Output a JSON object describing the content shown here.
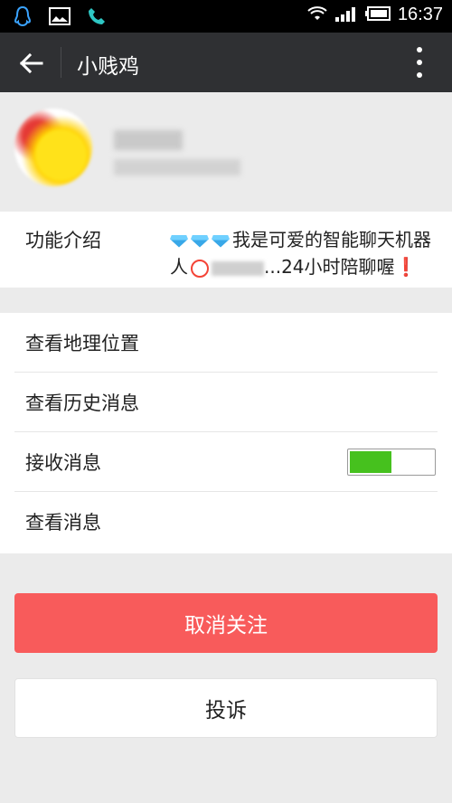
{
  "status_bar": {
    "time": "16:37",
    "left_icons": [
      "qq-icon",
      "image-icon",
      "phone-icon"
    ],
    "right_icons": [
      "wifi-icon",
      "signal-icon",
      "battery-icon"
    ]
  },
  "header": {
    "title": "小贱鸡"
  },
  "intro": {
    "label": "功能介绍",
    "text_part1": "我是可爱的智能聊天机器人",
    "text_part2": "...24小时陪聊喔",
    "exclaim": "❗"
  },
  "options": [
    {
      "label": "查看地理位置"
    },
    {
      "label": "查看历史消息"
    },
    {
      "label": "接收消息",
      "toggle_on": true
    },
    {
      "label": "查看消息"
    }
  ],
  "buttons": {
    "unfollow": "取消关注",
    "report": "投诉"
  },
  "colors": {
    "statusbar": "#000000",
    "actionbar": "#2f3033",
    "background": "#ebebeb",
    "toggle_green": "#46c11e",
    "danger_button": "#f85b5b"
  }
}
